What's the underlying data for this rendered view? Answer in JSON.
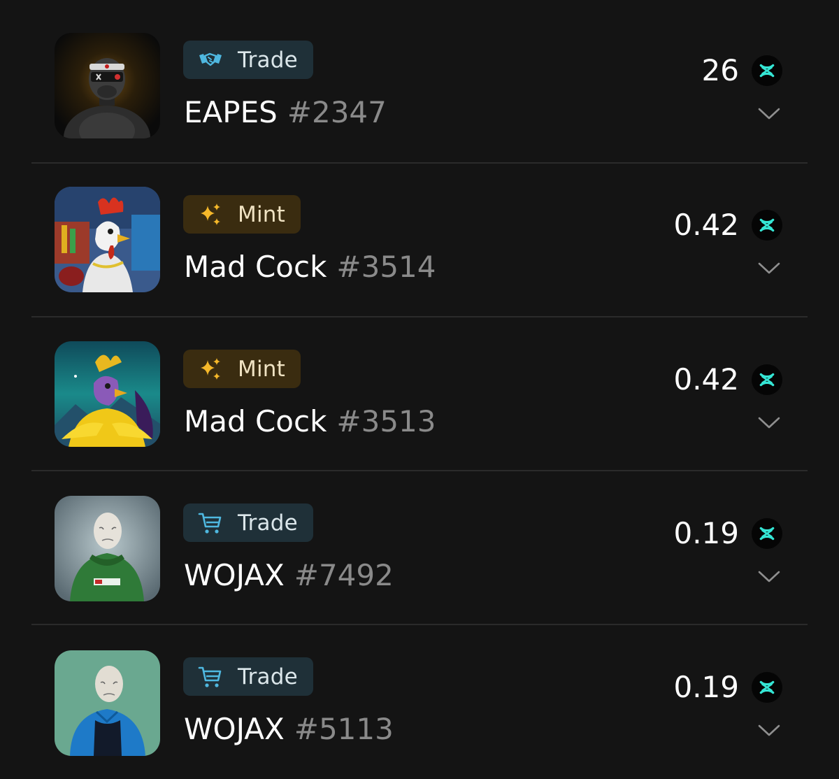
{
  "accent_coin": "#35e6d5",
  "colors": {
    "background": "#141414",
    "trade_badge_bg": "#1f3038",
    "trade_icon": "#4fb8e0",
    "mint_badge_bg": "#3a2c10",
    "mint_icon": "#f5b82a",
    "muted_number": "#8a8a8a"
  },
  "items": [
    {
      "badge": {
        "label": "Trade",
        "icon": "handshake-icon",
        "kind": "trade"
      },
      "collection": "EAPES",
      "number": "#2347",
      "price": "26",
      "currency_icon": "x-token-icon",
      "expand_icon": "chevron-down-icon"
    },
    {
      "badge": {
        "label": "Mint",
        "icon": "sparkles-icon",
        "kind": "mint"
      },
      "collection": "Mad Cock",
      "number": "#3514",
      "price": "0.42",
      "currency_icon": "x-token-icon",
      "expand_icon": "chevron-down-icon"
    },
    {
      "badge": {
        "label": "Mint",
        "icon": "sparkles-icon",
        "kind": "mint"
      },
      "collection": "Mad Cock",
      "number": "#3513",
      "price": "0.42",
      "currency_icon": "x-token-icon",
      "expand_icon": "chevron-down-icon"
    },
    {
      "badge": {
        "label": "Trade",
        "icon": "cart-icon",
        "kind": "trade"
      },
      "collection": "WOJAX",
      "number": "#7492",
      "price": "0.19",
      "currency_icon": "x-token-icon",
      "expand_icon": "chevron-down-icon"
    },
    {
      "badge": {
        "label": "Trade",
        "icon": "cart-icon",
        "kind": "trade"
      },
      "collection": "WOJAX",
      "number": "#5113",
      "price": "0.19",
      "currency_icon": "x-token-icon",
      "expand_icon": "chevron-down-icon"
    }
  ]
}
